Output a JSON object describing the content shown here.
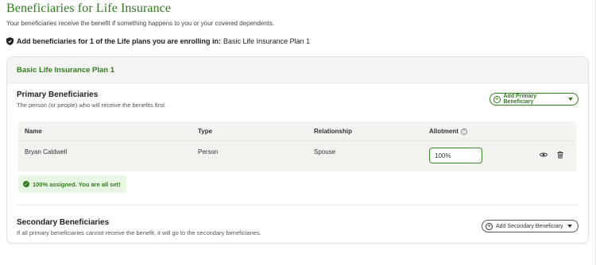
{
  "page": {
    "title": "Beneficiaries for Life Insurance",
    "subtitle": "Your beneficiaries receive the benefit if something happens to you or your covered dependents.",
    "enroll_prompt": "Add beneficiaries for 1 of the Life plans you are enrolling in:",
    "enroll_plan": "Basic Life Insurance Plan 1"
  },
  "plan": {
    "title": "Basic Life Insurance Plan 1",
    "primary": {
      "title": "Primary Beneficiaries",
      "description": "The person (or people) who will receive the benefits first.",
      "add_label": "Add Primary Beneficiary",
      "columns": [
        "Name",
        "Type",
        "Relationship",
        "Allotment"
      ],
      "rows": [
        {
          "name": "Bryan Caldwell",
          "type": "Person",
          "relationship": "Spouse",
          "allotment": "100%"
        }
      ],
      "status": "100% assigned. You are all set!"
    },
    "secondary": {
      "title": "Secondary Beneficiaries",
      "description": "If all primary beneficiaries cannot receive the benefit, it will go to the secondary beneficiaries.",
      "add_label": "Add Secondary Beneficiary"
    }
  },
  "colors": {
    "accent_green": "#2f7d1b",
    "success_bg": "#e8f6e4",
    "table_bg": "#f2f2ef"
  },
  "icons": [
    "shield-icon",
    "plus-circle-icon",
    "chevron-down-icon",
    "info-icon",
    "eye-icon",
    "trash-icon",
    "check-circle-icon"
  ]
}
